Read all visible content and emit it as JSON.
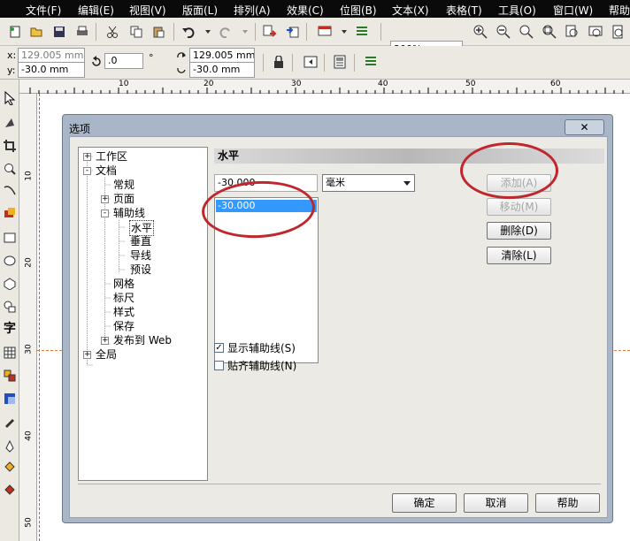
{
  "menu": {
    "items": [
      "文件(F)",
      "编辑(E)",
      "视图(V)",
      "版面(L)",
      "排列(A)",
      "效果(C)",
      "位图(B)",
      "文本(X)",
      "表格(T)",
      "工具(O)",
      "窗口(W)",
      "帮助"
    ]
  },
  "toolbar": {
    "zoom_value": "300%"
  },
  "propbar": {
    "x_label": "x:",
    "x_value": "129.005 mm",
    "y_label": "y:",
    "y_value": "-30.0 mm",
    "angle_value": ".0",
    "degree_symbol": "°",
    "pos_x": "129.005 mm",
    "pos_y": "-30.0 mm"
  },
  "ruler": {
    "h_ticks": [
      "10",
      "20",
      "30",
      "40",
      "50",
      "60"
    ],
    "v_ticks": [
      "10",
      "20",
      "30",
      "40",
      "50"
    ]
  },
  "dialog": {
    "title": "选项",
    "close": "✕",
    "tree": [
      {
        "label": "工作区",
        "expander": "+",
        "level": 0
      },
      {
        "label": "文档",
        "expander": "-",
        "level": 0
      },
      {
        "label": "常规",
        "expander": "",
        "level": 1
      },
      {
        "label": "页面",
        "expander": "+",
        "level": 1
      },
      {
        "label": "辅助线",
        "expander": "-",
        "level": 1
      },
      {
        "label": "水平",
        "expander": "",
        "level": 2,
        "selected": true
      },
      {
        "label": "垂直",
        "expander": "",
        "level": 2
      },
      {
        "label": "导线",
        "expander": "",
        "level": 2
      },
      {
        "label": "预设",
        "expander": "",
        "level": 2
      },
      {
        "label": "网格",
        "expander": "",
        "level": 1
      },
      {
        "label": "标尺",
        "expander": "",
        "level": 1
      },
      {
        "label": "样式",
        "expander": "",
        "level": 1
      },
      {
        "label": "保存",
        "expander": "",
        "level": 1
      },
      {
        "label": "发布到 Web",
        "expander": "+",
        "level": 1
      },
      {
        "label": "全局",
        "expander": "+",
        "level": 0
      }
    ],
    "panel_title": "水平",
    "value_input": "-30.000",
    "unit_select": "毫米",
    "list_items": [
      "-30.000"
    ],
    "buttons": {
      "add": "添加(A)",
      "move": "移动(M)",
      "delete": "删除(D)",
      "clear": "清除(L)"
    },
    "checkboxes": {
      "show_label": "显示辅助线(S)",
      "show_checked": true,
      "snap_label": "贴齐辅助线(N)",
      "snap_checked": false
    },
    "footer": {
      "ok": "确定",
      "cancel": "取消",
      "help": "帮助"
    }
  },
  "colors": {
    "annotation": "#c0272d",
    "selection": "#3399ff",
    "menubar_bg": "#0a0a0a",
    "guide_line": "#e07a3a"
  }
}
